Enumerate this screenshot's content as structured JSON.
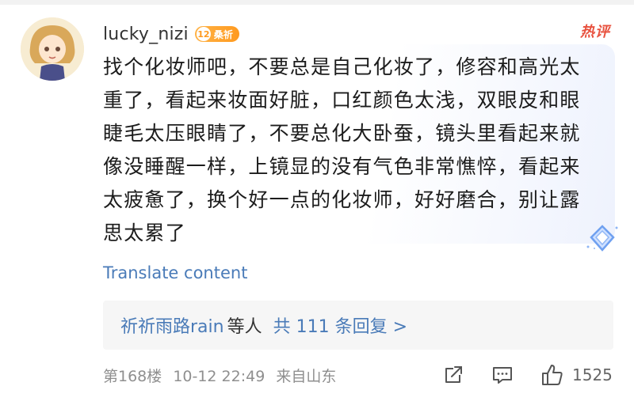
{
  "comment": {
    "username": "lucky_nizi",
    "level": "12",
    "level_title": "桑祈",
    "hot_tag": "热评",
    "text": "找个化妆师吧，不要总是自己化妆了，修容和高光太重了，看起来妆面好脏，口红颜色太浅，双眼皮和眼睫毛太压眼睛了，不要总化大卧蚕，镜头里看起来就像没睡醒一样，上镜显的没有气色非常憔悴，看起来太疲惫了，换个好一点的化妆师，好好磨合，别让露思太累了",
    "translate_label": "Translate content"
  },
  "replies": {
    "names": "祈祈雨路rain",
    "etc": "等人",
    "count_label": "共 111 条回复 >"
  },
  "footer": {
    "floor": "第168楼",
    "timestamp": "10-12 22:49",
    "location": "来自山东",
    "like_count": "1525"
  },
  "icons": {
    "avatar": "avatar-cartoon-girl",
    "share": "share-icon",
    "comment": "comment-icon",
    "like": "thumbs-up-icon",
    "decoration": "diamond-icon"
  },
  "colors": {
    "link": "#4a7bb8",
    "hot": "#e8523f",
    "badge": "#ff9a1f",
    "meta": "#8f8f8f"
  }
}
